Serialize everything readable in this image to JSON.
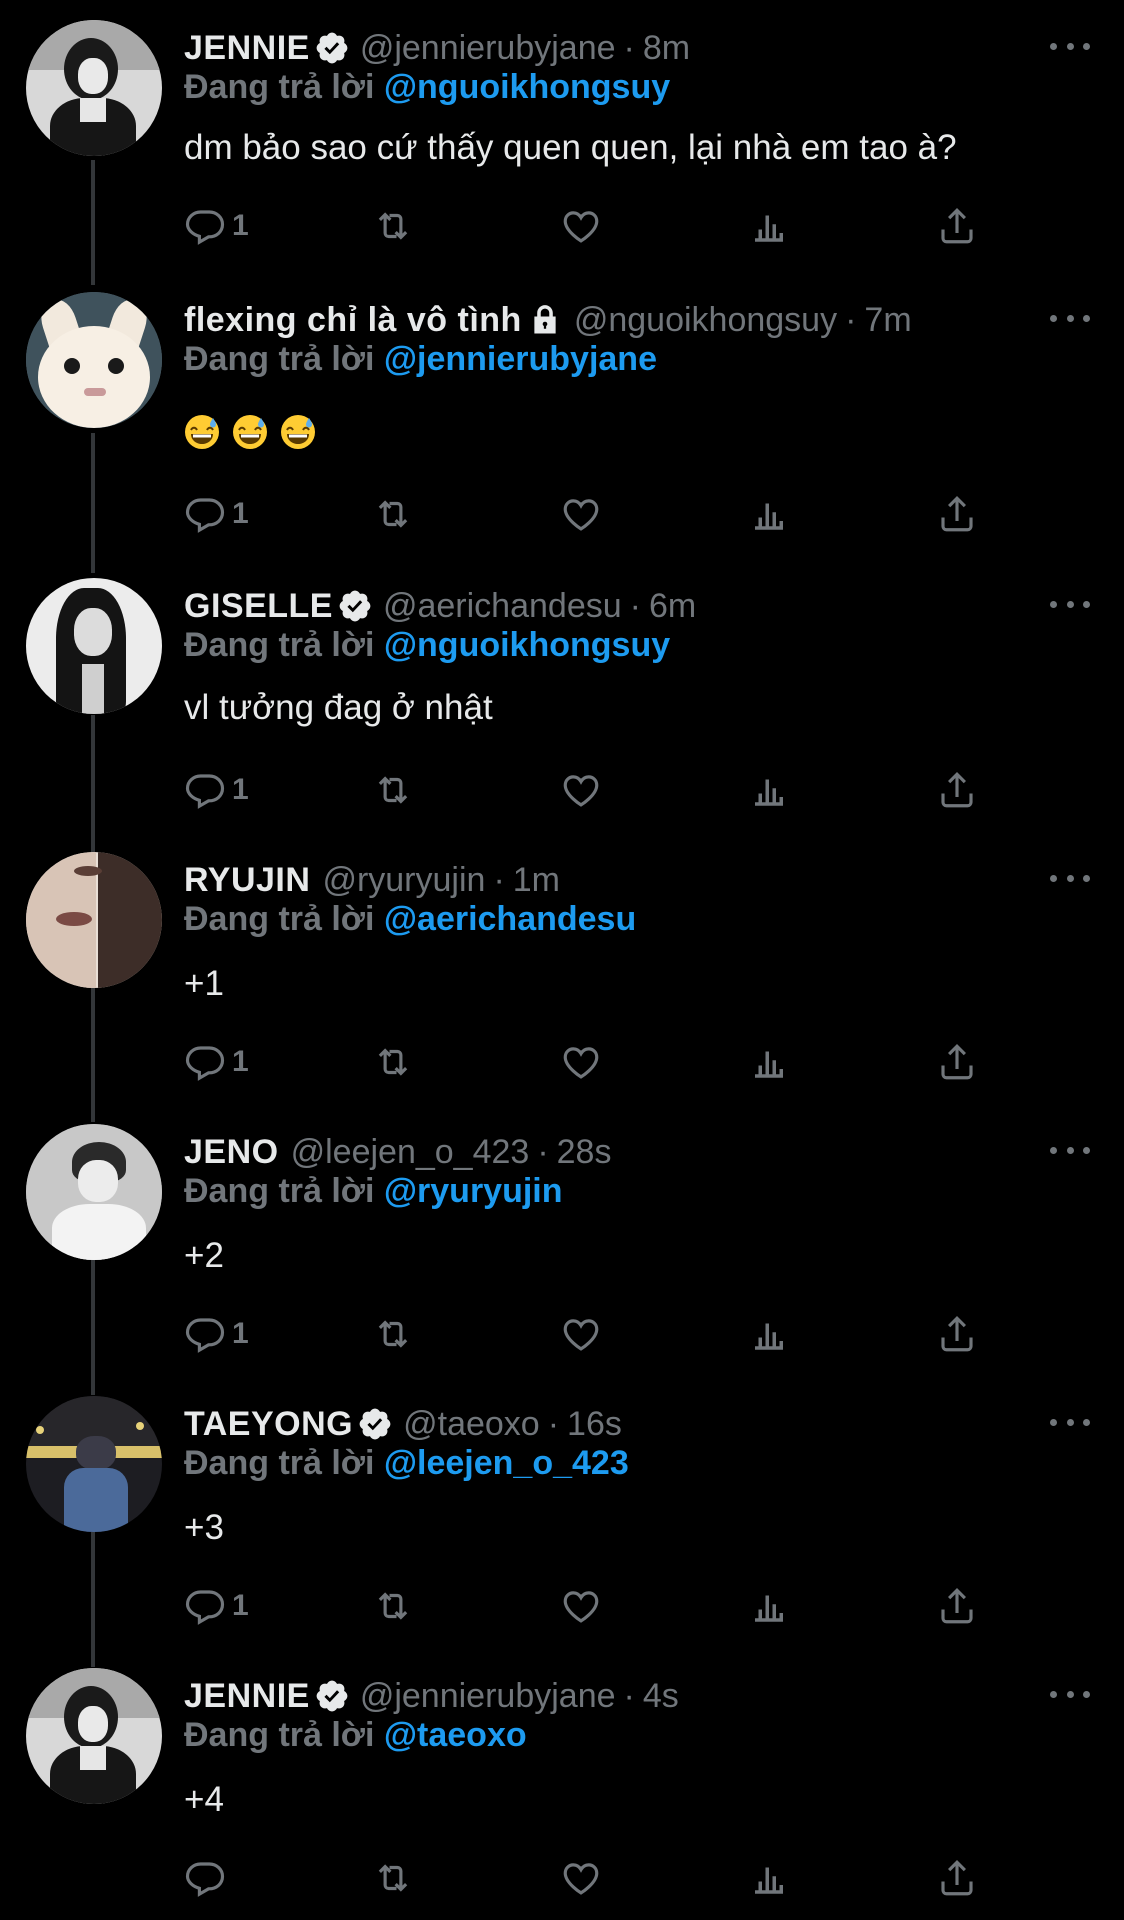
{
  "colors": {
    "background": "#000000",
    "name": "#e7e9ea",
    "muted": "#71767b",
    "mention": "#1d9bf0",
    "thread_line": "#333639"
  },
  "reply_prefix": "Đang trả lời",
  "tweets": [
    {
      "name": "JENNIE",
      "verified": true,
      "locked": false,
      "handle": "@jennierubyjane",
      "time": "8m",
      "reply_to": "@nguoikhongsuy",
      "text": "dm bảo sao cứ thấy quen quen, lại nhà em tao à?",
      "reply_count": "1"
    },
    {
      "name": "flexing chỉ là vô tình",
      "verified": false,
      "locked": true,
      "handle": "@nguoikhongsuy",
      "time": "7m",
      "reply_to": "@jennierubyjane",
      "text": "",
      "emojis": [
        "grinning-face-with-sweat",
        "grinning-face-with-sweat",
        "grinning-face-with-sweat"
      ],
      "reply_count": "1"
    },
    {
      "name": "GISELLE",
      "verified": true,
      "locked": false,
      "handle": "@aerichandesu",
      "time": "6m",
      "reply_to": "@nguoikhongsuy",
      "text": "vl tưởng đag ở nhật",
      "reply_count": "1"
    },
    {
      "name": "RYUJIN",
      "verified": false,
      "locked": false,
      "handle": "@ryuryujin",
      "time": "1m",
      "reply_to": "@aerichandesu",
      "text": "+1",
      "reply_count": "1"
    },
    {
      "name": "JENO",
      "verified": false,
      "locked": false,
      "handle": "@leejen_o_423",
      "time": "28s",
      "reply_to": "@ryuryujin",
      "text": "+2",
      "reply_count": "1"
    },
    {
      "name": "TAEYONG",
      "verified": true,
      "locked": false,
      "handle": "@taeoxo",
      "time": "16s",
      "reply_to": "@leejen_o_423",
      "text": "+3",
      "reply_count": "1"
    },
    {
      "name": "JENNIE",
      "verified": true,
      "locked": false,
      "handle": "@jennierubyjane",
      "time": "4s",
      "reply_to": "@taeoxo",
      "text": "+4",
      "reply_count": ""
    }
  ]
}
